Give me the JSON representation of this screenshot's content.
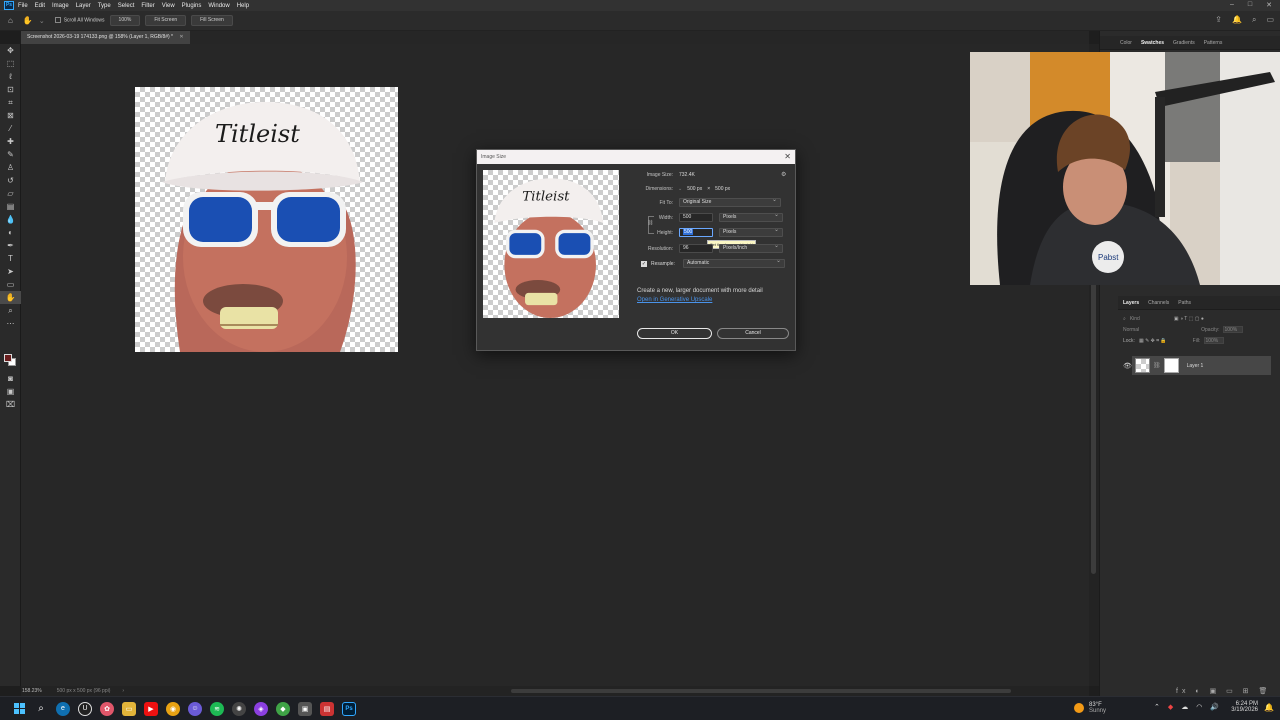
{
  "menubar": {
    "app_icon": "Ps",
    "items": [
      "File",
      "Edit",
      "Image",
      "Layer",
      "Type",
      "Select",
      "Filter",
      "View",
      "Plugins",
      "Window",
      "Help"
    ],
    "window_controls": [
      "–",
      "□",
      "✕"
    ]
  },
  "options_bar": {
    "scroll_all_windows": "Scroll All Windows",
    "zoom": "100%",
    "fit_screen": "Fit Screen",
    "fill_screen": "Fill Screen"
  },
  "document": {
    "tab_title": "Screenshot 2026-03-19 174133.png @ 158% (Layer 1, RGB/8#) *",
    "tab_close": "✕"
  },
  "status": {
    "zoom": "158.23%",
    "doc_info": "500 px x 500 px (96 ppi)"
  },
  "top_panel_tabs": [
    "Color",
    "Swatches",
    "Gradients",
    "Patterns"
  ],
  "layers_panel": {
    "tabs": [
      "Layers",
      "Channels",
      "Paths"
    ],
    "filter_placeholder": "Kind",
    "blend_mode": "Normal",
    "opacity_label": "Opacity:",
    "opacity_value": "100%",
    "lock_label": "Lock:",
    "fill_label": "Fill:",
    "fill_value": "100%",
    "layer_name": "Layer 1"
  },
  "dialog": {
    "title": "Image Size",
    "image_size_label": "Image Size:",
    "image_size_value": "732.4K",
    "dimensions_label": "Dimensions:",
    "dim_w": "500 px",
    "dim_x": "×",
    "dim_h": "500 px",
    "fit_to_label": "Fit To:",
    "fit_to_value": "Original Size",
    "width_label": "Width:",
    "width_value": "500",
    "width_unit": "Pixels",
    "height_label": "Height:",
    "height_value": "500",
    "height_unit": "Pixels",
    "tooltip": "Set the document height",
    "resolution_label": "Resolution:",
    "resolution_value": "96",
    "resolution_unit": "Pixels/Inch",
    "resample_label": "Resample:",
    "resample_value": "Automatic",
    "note": "Create a new, larger document with more detail",
    "link": "Open in Generative Upscale",
    "ok": "OK",
    "cancel": "Cancel"
  },
  "taskbar": {
    "weather_temp": "83°F",
    "weather_desc": "Sunny",
    "time": "6:24 PM",
    "date": "3/19/2026"
  },
  "colors": {
    "accent": "#31a8ff",
    "foreground_swatch": "#6b1e1e",
    "background_swatch": "#ffffff"
  }
}
